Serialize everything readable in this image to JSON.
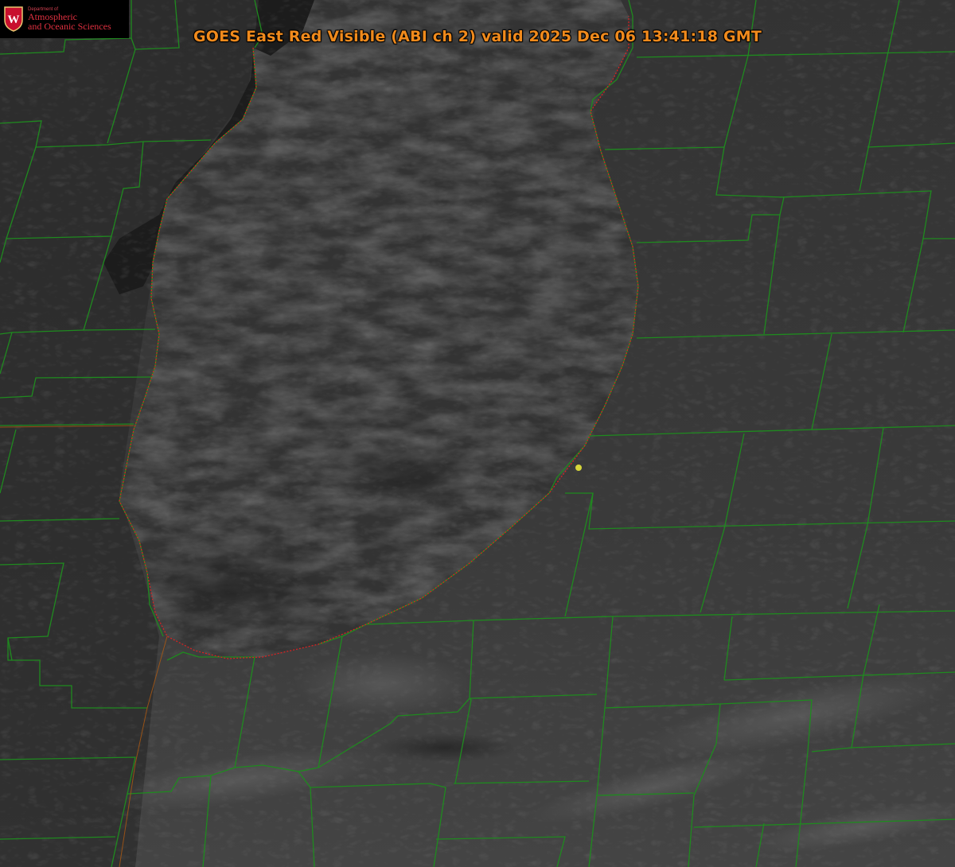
{
  "title": "GOES East Red Visible (ABI ch 2) valid 2025 Dec 06 13:41:18 GMT",
  "logo": {
    "department": "Department of",
    "line1": "Atmospheric",
    "line2": "and Oceanic Sciences",
    "crest_letter": "W"
  },
  "colors": {
    "title": "#f08a1c",
    "county_lines": "#1f8a1f",
    "lake_outline": "#e02020",
    "state_line": "#b05a10",
    "marker": "#d6d63a",
    "logo_text": "#e03040"
  },
  "icons": [
    "university-crest-icon",
    "location-marker-icon"
  ]
}
